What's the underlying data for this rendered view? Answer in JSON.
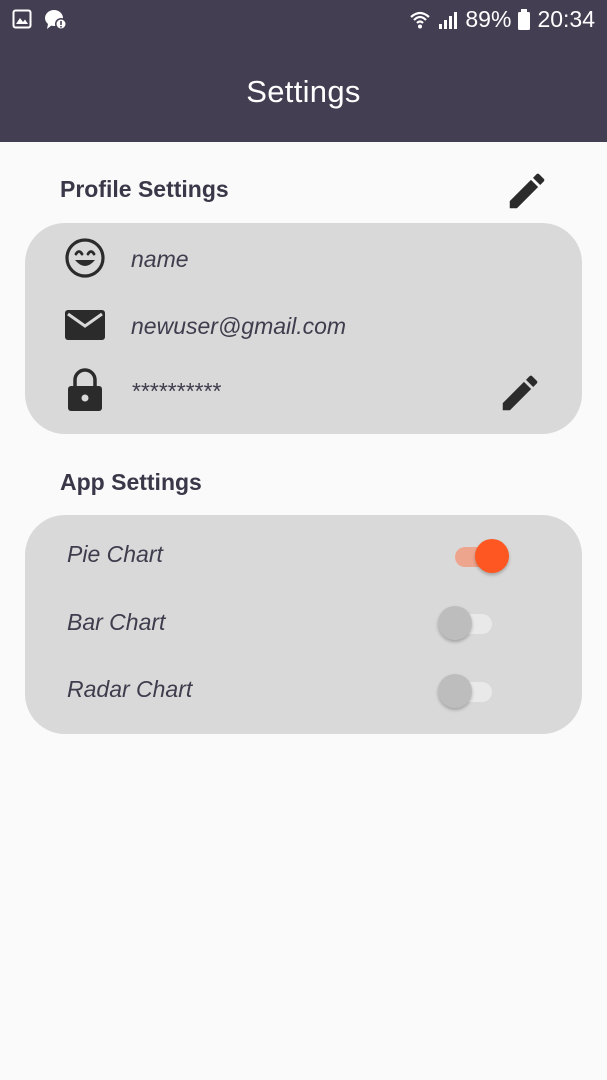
{
  "status_bar": {
    "battery": "89%",
    "time": "20:34",
    "left_icons": [
      "gallery-icon",
      "chat-notification-icon"
    ],
    "right_icons": [
      "wifi-icon",
      "signal-icon",
      "battery-icon"
    ]
  },
  "appbar": {
    "title": "Settings"
  },
  "profile": {
    "title": "Profile Settings",
    "name": "name",
    "email": "newuser@gmail.com",
    "password": "**********",
    "icons": [
      "smile-icon",
      "mail-icon",
      "lock-icon",
      "pencil-icon"
    ]
  },
  "app_settings": {
    "title": "App Settings",
    "toggles": [
      {
        "label": "Pie Chart",
        "on": true
      },
      {
        "label": "Bar Chart",
        "on": false
      },
      {
        "label": "Radar Chart",
        "on": false
      }
    ]
  },
  "colors": {
    "header_bg": "#433e52",
    "page_bg": "#fafafa",
    "card_bg": "#d9d9d9",
    "accent": "#ff5722",
    "accent_track": "#eea58e",
    "off_thumb": "#bdbdbd",
    "off_track": "#e9e9e9",
    "text": "#3f3d4d"
  }
}
